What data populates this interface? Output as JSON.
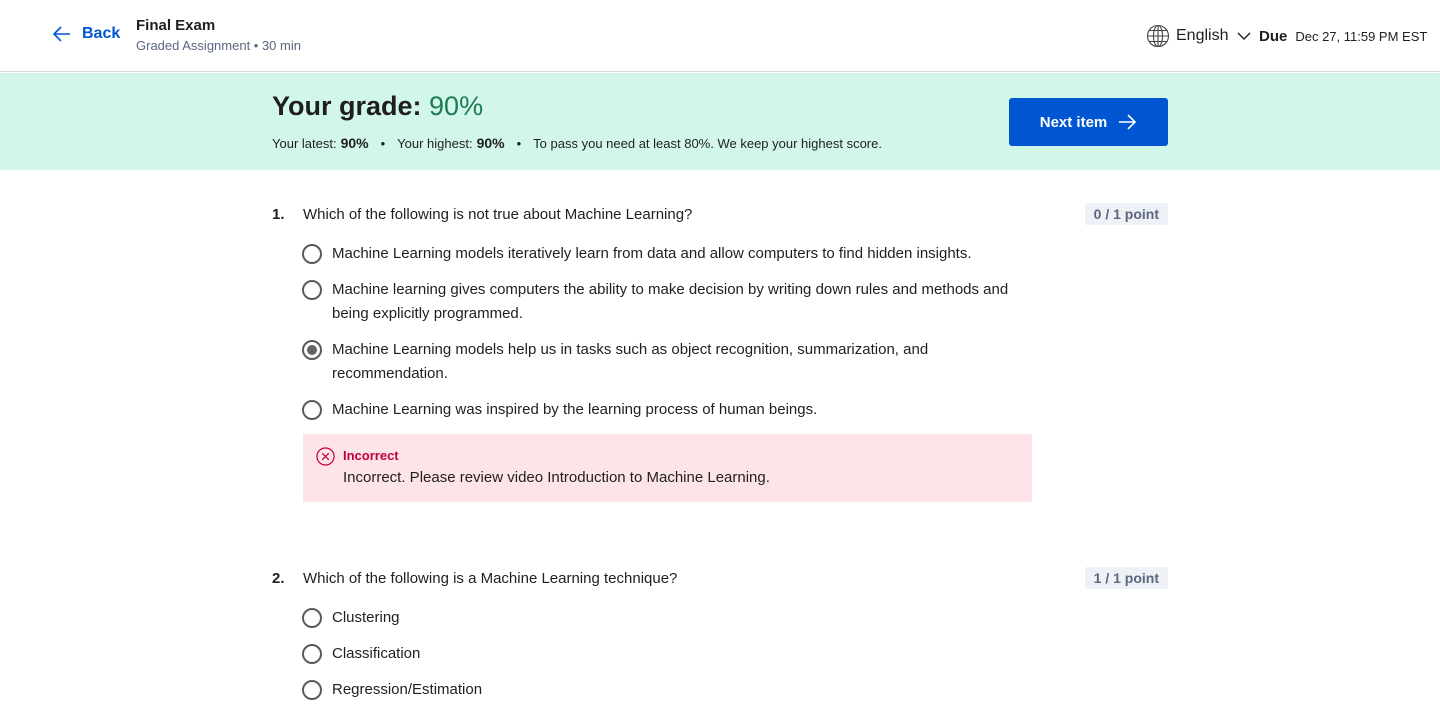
{
  "header": {
    "back_label": "Back",
    "title": "Final Exam",
    "subtitle": "Graded Assignment • 30 min",
    "language": "English",
    "due_label": "Due",
    "due_value": "Dec 27, 11:59 PM EST"
  },
  "banner": {
    "grade_label": "Your grade:",
    "grade_value": "90%",
    "latest_label": "Your latest:",
    "latest_value": "90%",
    "highest_label": "Your highest:",
    "highest_value": "90%",
    "pass_note": "To pass you need at least 80%. We keep your highest score.",
    "separator": "•",
    "next_label": "Next item"
  },
  "questions": [
    {
      "number": "1.",
      "text": "Which of the following is not true about Machine Learning?",
      "points": "0 / 1 point",
      "options": [
        {
          "label": "Machine Learning models iteratively learn from data and allow computers to find hidden insights.",
          "selected": false
        },
        {
          "label": "Machine learning gives computers the ability to make decision by writing down rules and methods and being explicitly programmed.",
          "selected": false
        },
        {
          "label": "Machine Learning models help us in tasks such as object recognition, summarization, and recommendation.",
          "selected": true
        },
        {
          "label": "Machine Learning was inspired by the learning process of human beings.",
          "selected": false
        }
      ],
      "feedback": {
        "heading": "Incorrect",
        "message": "Incorrect. Please review video Introduction to Machine Learning.",
        "color": "#c4003a"
      }
    },
    {
      "number": "2.",
      "text": "Which of the following is a Machine Learning technique?",
      "points": "1 / 1 point",
      "options": [
        {
          "label": "Clustering",
          "selected": false
        },
        {
          "label": "Classification",
          "selected": false
        },
        {
          "label": "Regression/Estimation",
          "selected": false
        }
      ]
    }
  ],
  "colors": {
    "accent": "#0056d2",
    "banner_bg": "#d2f7ea",
    "grade_green": "#1c7c54",
    "error_bg": "#fce4e8"
  }
}
